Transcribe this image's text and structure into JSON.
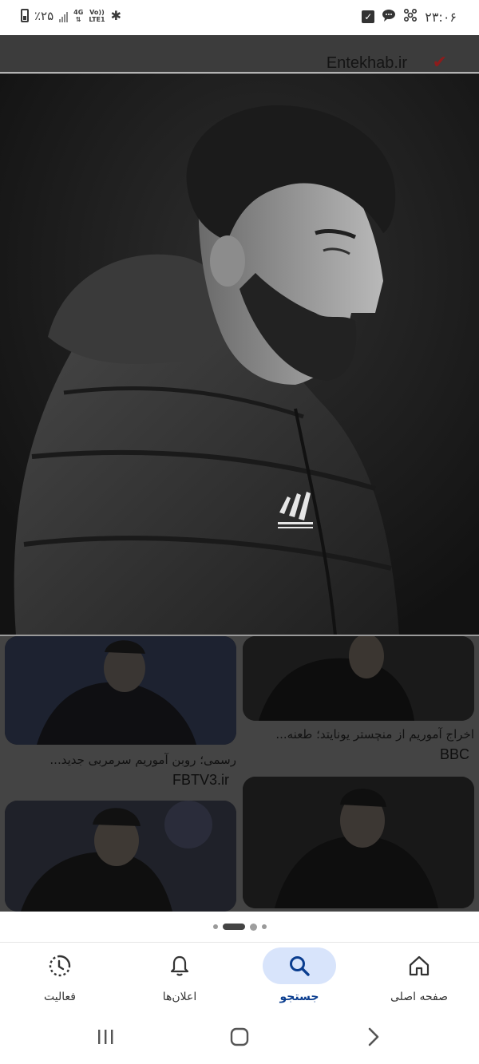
{
  "status_bar": {
    "battery": "٪۲۵",
    "network_top": "4G",
    "network_bottom": "LTE1",
    "volte_top": "Vo))",
    "volte_bottom": "LTE1",
    "time": "۲۳:۰۶"
  },
  "viewer": {
    "source": "Entekhab.ir",
    "source_mark": "✔"
  },
  "results": [
    {
      "title": "اخراج آموریم از منچستر یونایتد؛ طعنه...",
      "source": "BBC"
    },
    {
      "title": "رسمی؛ روبن آموریم سرمربی جدید...",
      "source": "FBTV3.ir"
    }
  ],
  "bottom_nav": {
    "items": [
      {
        "label": "فعالیت",
        "icon": "activity-icon"
      },
      {
        "label": "اعلان‌ها",
        "icon": "bell-icon"
      },
      {
        "label": "جستجو",
        "icon": "search-icon",
        "active": true
      },
      {
        "label": "صفحه اصلی",
        "icon": "home-icon"
      }
    ]
  },
  "colors": {
    "accent": "#0a3d8f",
    "active_pill": "#d8e4fb"
  }
}
